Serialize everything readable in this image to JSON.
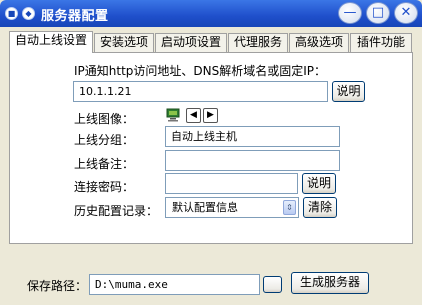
{
  "window": {
    "title": "服务器配置",
    "minimize_glyph": "—",
    "maximize_glyph": "□",
    "close_glyph": "✕"
  },
  "tabs": [
    {
      "label": "自动上线设置",
      "active": true
    },
    {
      "label": "安装选项",
      "active": false
    },
    {
      "label": "启动项设置",
      "active": false
    },
    {
      "label": "代理服务",
      "active": false
    },
    {
      "label": "高级选项",
      "active": false
    },
    {
      "label": "插件功能",
      "active": false
    }
  ],
  "auto_online": {
    "ip_notice_label": "IP通知http访问地址、DNS解析域名或固定IP：",
    "ip_value": "10.1.1.21",
    "ip_help_button": "说明",
    "online_image_label": "上线图像：",
    "online_group_label": "上线分组：",
    "online_group_value": "自动上线主机",
    "online_remark_label": "上线备注：",
    "online_remark_value": "",
    "password_label": "连接密码：",
    "password_value": "",
    "password_help_button": "说明",
    "history_label": "历史配置记录：",
    "history_selected": "默认配置信息",
    "clear_button": "清除"
  },
  "footer": {
    "save_path_label": "保存路径：",
    "save_path_value": "D:\\muma.exe",
    "generate_button": "生成服务器"
  },
  "colors": {
    "titlebar": "#1F4FCB",
    "face": "#ECE9D8",
    "panel": "#FFFFFF",
    "field_border": "#7F9DB9"
  }
}
